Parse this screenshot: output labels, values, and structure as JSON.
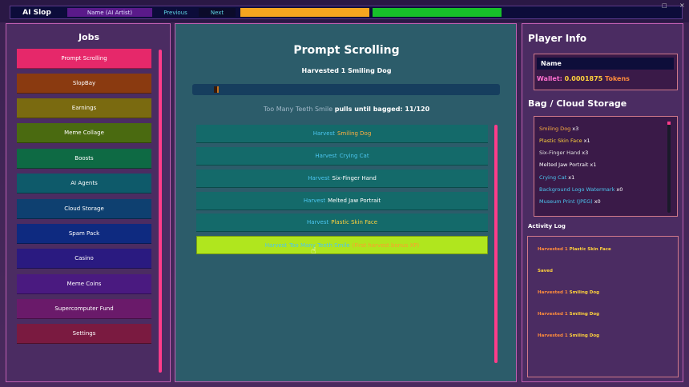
{
  "app": {
    "title": "AI Slop",
    "name_field": "Name (AI Artist)",
    "prev_label": "Previous",
    "next_label": "Next",
    "orange_color": "#f5a51f",
    "green_color": "#17c02a"
  },
  "window": {
    "restore_icon": "□",
    "close_icon": "×"
  },
  "jobs": {
    "title": "Jobs",
    "items": [
      {
        "label": "Prompt Scrolling",
        "color": "#e6286a"
      },
      {
        "label": "SlopBay",
        "color": "#8a3a10"
      },
      {
        "label": "Earnings",
        "color": "#7a6a10"
      },
      {
        "label": "Meme Collage",
        "color": "#4a6a10"
      },
      {
        "label": "Boosts",
        "color": "#0e6a44"
      },
      {
        "label": "AI Agents",
        "color": "#0e5a6a"
      },
      {
        "label": "Cloud Storage",
        "color": "#0e4070"
      },
      {
        "label": "Spam Pack",
        "color": "#0e2a80"
      },
      {
        "label": "Casino",
        "color": "#2a1a80"
      },
      {
        "label": "Meme Coins",
        "color": "#4a1a80"
      },
      {
        "label": "Supercomputer Fund",
        "color": "#6a1a6a"
      },
      {
        "label": "Settings",
        "color": "#7a1a40"
      }
    ]
  },
  "center": {
    "title": "Prompt Scrolling",
    "status": "Harvested 1 Smiling Dog",
    "progress_fraction": 0.0167,
    "pulls_item": "Too Many Teeth Smile",
    "pulls_rest": "pulls until bagged: 11/120",
    "rows": [
      {
        "verb": "Harvest",
        "item": "Smiling Dog",
        "item_color": "#ffb040",
        "bonus": ""
      },
      {
        "verb": "Harvest",
        "item": "Crying Cat",
        "item_color": "#4cc6f0",
        "bonus": ""
      },
      {
        "verb": "Harvest",
        "item": "Six-Finger Hand",
        "item_color": "#ffffff",
        "bonus": ""
      },
      {
        "verb": "Harvest",
        "item": "Melted Jaw Portrait",
        "item_color": "#ffffff",
        "bonus": ""
      },
      {
        "verb": "Harvest",
        "item": "Plastic Skin Face",
        "item_color": "#ffd23c",
        "bonus": ""
      },
      {
        "verb": "Harvest",
        "item": "Too Many Teeth Smile",
        "item_color": "#4cc6f0",
        "bonus": "(First harvest bonus XP)"
      }
    ]
  },
  "player": {
    "title": "Player Info",
    "name": "Name",
    "wallet_label": "Wallet:",
    "wallet_value": "0.0001875",
    "wallet_unit": "Tokens"
  },
  "bag": {
    "title": "Bag / Cloud Storage",
    "items": [
      {
        "name": "Smiling Dog",
        "count": "x3",
        "color": "#ffb040"
      },
      {
        "name": "Plastic Skin Face",
        "count": "x1",
        "color": "#ffd23c"
      },
      {
        "name": "Six-Finger Hand",
        "count": "x3",
        "color": "#e0e0e0"
      },
      {
        "name": "Melted Jaw Portrait",
        "count": "x1",
        "color": "#ffffff"
      },
      {
        "name": "Crying Cat",
        "count": "x1",
        "color": "#4cc6f0"
      },
      {
        "name": "Background Logo Watermark",
        "count": "x0",
        "color": "#4cc6f0"
      },
      {
        "name": "Museum Print (JPEG)",
        "count": "x0",
        "color": "#4cc6f0"
      }
    ]
  },
  "activity": {
    "title": "Activity Log",
    "entries": [
      {
        "verb": "Harvested 1",
        "item": "Plastic Skin Face"
      },
      {
        "verb": "",
        "item": "Saved"
      },
      {
        "verb": "Harvested 1",
        "item": "Smiling Dog"
      },
      {
        "verb": "Harvested 1",
        "item": "Smiling Dog"
      },
      {
        "verb": "Harvested 1",
        "item": "Smiling Dog"
      }
    ]
  },
  "icons": {
    "cursor": "cursor-hand-icon"
  }
}
